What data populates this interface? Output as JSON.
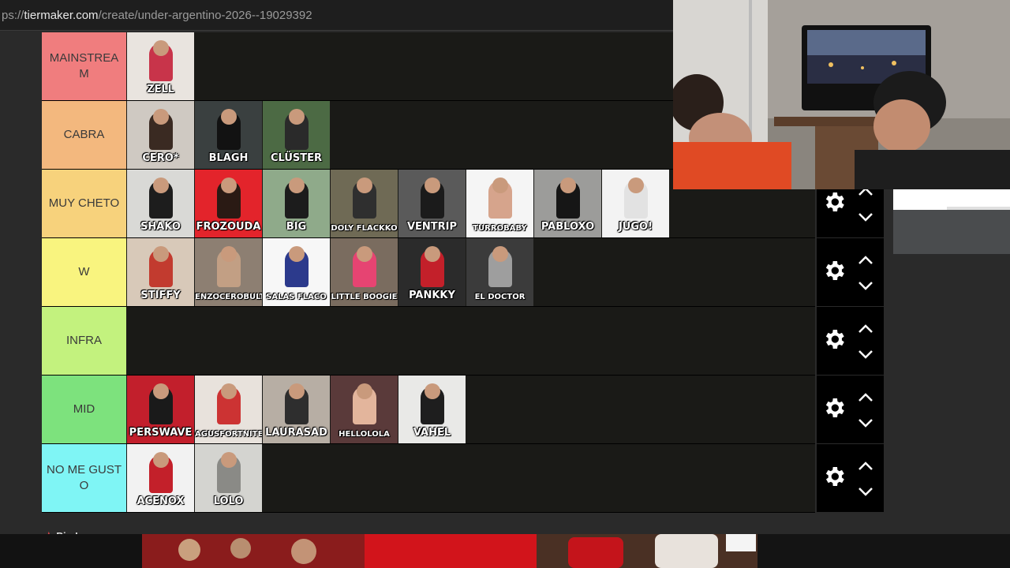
{
  "browser": {
    "url_prefix": "ps://",
    "url_domain": "tiermaker.com",
    "url_path": "/create/under-argentino-2026--19029392"
  },
  "tiers": [
    {
      "label": "MAINSTREAM",
      "color": "#f07d7e",
      "items": [
        {
          "name": "ZELL",
          "bg": "#e9e4df",
          "accent": "#c8344a"
        }
      ]
    },
    {
      "label": "CABRA",
      "color": "#f3b87e",
      "items": [
        {
          "name": "CERO*",
          "bg": "#cfc9c2",
          "accent": "#3a2a22"
        },
        {
          "name": "BLAGH",
          "bg": "#3a4040",
          "accent": "#121212"
        },
        {
          "name": "CLÜSTER",
          "bg": "#4c6a44",
          "accent": "#2a2a2a"
        }
      ]
    },
    {
      "label": "MUY CHETO",
      "color": "#f7d27c",
      "items": [
        {
          "name": "SHAKO",
          "bg": "#d9d9d6",
          "accent": "#1d1d1d"
        },
        {
          "name": "FROZOUDA",
          "bg": "#e3242b",
          "accent": "#2a1a14"
        },
        {
          "name": "BIG",
          "bg": "#8faa8a",
          "accent": "#1c1c1c"
        },
        {
          "name": "DOLY FLACKKO",
          "bg": "#6f6a55",
          "accent": "#2f2f2f"
        },
        {
          "name": "VENTRIP",
          "bg": "#5a5a5a",
          "accent": "#1b1b1b"
        },
        {
          "name": "TURROBABY",
          "bg": "#f5f5f5",
          "accent": "#d6a48c"
        },
        {
          "name": "PABLOXO",
          "bg": "#9c9c9a",
          "accent": "#161616"
        },
        {
          "name": "JUGO!",
          "bg": "#f3f3f3",
          "accent": "#e2e2e2"
        }
      ]
    },
    {
      "label": "W",
      "color": "#f9f47f",
      "items": [
        {
          "name": "STIFFY",
          "bg": "#d8c9b9",
          "accent": "#c23b2f"
        },
        {
          "name": "ENZOCEROBULTO",
          "bg": "#8d7f72",
          "accent": "#c29f84"
        },
        {
          "name": "SALAS FLACO",
          "bg": "#f7f7f7",
          "accent": "#2c3a8c"
        },
        {
          "name": "LITTLE BOOGIE",
          "bg": "#7a6c5f",
          "accent": "#e64472"
        },
        {
          "name": "PANKKY",
          "bg": "#2b2b2b",
          "accent": "#c3202a"
        },
        {
          "name": "EL DOCTOR",
          "bg": "#3b3b3b",
          "accent": "#9e9e9e"
        }
      ]
    },
    {
      "label": "INFRA",
      "color": "#c3f27e",
      "items": []
    },
    {
      "label": "MID",
      "color": "#7de27d",
      "items": [
        {
          "name": "PERSWAVE",
          "bg": "#c21f2c",
          "accent": "#1a1a1a"
        },
        {
          "name": "AGUSFORTNITE",
          "bg": "#e8e2dc",
          "accent": "#c33"
        },
        {
          "name": "LAURASAD",
          "bg": "#b7aea4",
          "accent": "#2e2e2e"
        },
        {
          "name": "HELLOLOLA",
          "bg": "#5a3a3a",
          "accent": "#e3b59c"
        },
        {
          "name": "VAHEL",
          "bg": "#e9e9e7",
          "accent": "#1e1e1e"
        }
      ]
    },
    {
      "label": "NO ME GUSTO",
      "color": "#7ff5f5",
      "items": [
        {
          "name": "ACENOX",
          "bg": "#f2f2f2",
          "accent": "#c3202a"
        },
        {
          "name": "LOLO",
          "bg": "#d4d4d0",
          "accent": "#8a8a86"
        }
      ]
    }
  ],
  "footer": {
    "pin_label": "Pin Images"
  }
}
